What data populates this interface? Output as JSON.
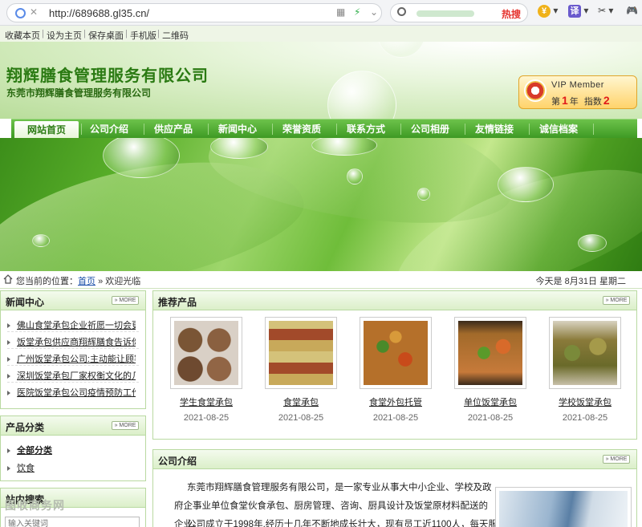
{
  "browser": {
    "url": "http://689688.gl35.cn/",
    "search_hot": "热搜",
    "security_mark": "✕"
  },
  "toplinks": [
    "收藏本页",
    "设为主页",
    "保存桌面",
    "手机版",
    "二维码"
  ],
  "header": {
    "title": "翔辉膳食管理服务有限公司",
    "subtitle": "东莞市翔辉膳食管理服务有限公司"
  },
  "vip": {
    "label": "VIP Member",
    "year_prefix": "第",
    "year": "1",
    "year_suffix": "年",
    "index_label": "指数",
    "index": "2"
  },
  "nav": [
    "网站首页",
    "公司介绍",
    "供应产品",
    "新闻中心",
    "荣誉资质",
    "联系方式",
    "公司相册",
    "友情链接",
    "诚信档案"
  ],
  "location": {
    "prefix": "您当前的位置：",
    "home": "首页",
    "sep": "»",
    "current": "欢迎光临",
    "date": "今天是  8月31日  星期二"
  },
  "news": {
    "title": "新闻中心",
    "more": "MORE",
    "items": [
      "佛山食堂承包企业祈愿一切会更",
      "饭堂承包供应商翔辉膳食告诉你",
      "广州饭堂承包公司:主动能让顾客",
      "深圳饭堂承包厂家权衡文化的几",
      "医院饭堂承包公司疫情预防工作"
    ]
  },
  "categories": {
    "title": "产品分类",
    "more": "MORE",
    "items": [
      "全部分类",
      "饮食"
    ]
  },
  "search_box": {
    "title": "站内搜索",
    "placeholder": "输入关键词"
  },
  "watermark": "图收商务网",
  "products": {
    "title": "推荐产品",
    "more": "MORE",
    "items": [
      {
        "name": "学生食堂承包",
        "date": "2021-08-25"
      },
      {
        "name": "食堂承包",
        "date": "2021-08-25"
      },
      {
        "name": "食堂外包托管",
        "date": "2021-08-25"
      },
      {
        "name": "单位饭堂承包",
        "date": "2021-08-25"
      },
      {
        "name": "学校饭堂承包",
        "date": "2021-08-25"
      }
    ]
  },
  "intro": {
    "title": "公司介绍",
    "more": "MORE",
    "p1": "东莞市翔辉膳食管理服务有限公司，是一家专业从事大中小企业、学校及政府企事业单位食堂伙食承包、厨房管理、咨询、厨具设计及饭堂原材料配送的企业。",
    "p2": "公司成立于1998年,经历十几年不断地成长壮大，现有员工近1100人，每天服"
  }
}
